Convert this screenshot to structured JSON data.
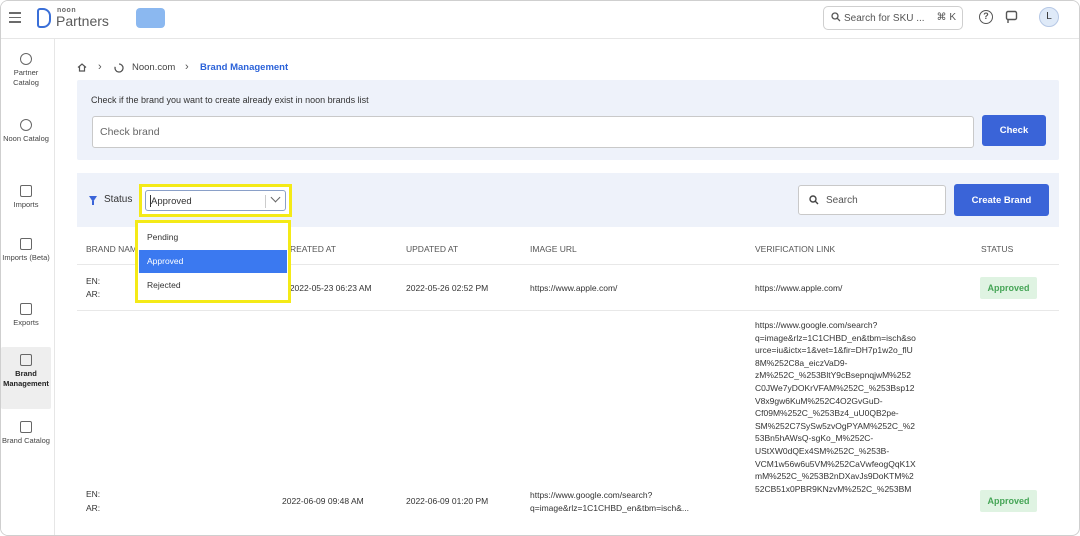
{
  "topbar": {
    "logo_small": "noon",
    "logo_big": "Partners",
    "search_placeholder": "Search for SKU ...",
    "search_shortcut": "⌘ K",
    "help": "?",
    "avatar": "L"
  },
  "sidebar": {
    "items": [
      {
        "label": "Partner Catalog",
        "icon": "partner-catalog-icon"
      },
      {
        "label": "Noon Catalog",
        "icon": "noon-catalog-icon"
      },
      {
        "label": "Imports",
        "icon": "imports-icon"
      },
      {
        "label": "Imports (Beta)",
        "icon": "imports-beta-icon"
      },
      {
        "label": "Exports",
        "icon": "exports-icon"
      },
      {
        "label": "Brand Management",
        "icon": "brand-management-icon",
        "active": true
      },
      {
        "label": "Brand Catalog",
        "icon": "brand-catalog-icon"
      }
    ]
  },
  "breadcrumb": {
    "store": "Noon.com",
    "current": "Brand Management"
  },
  "check": {
    "hint": "Check if the brand you want to create already exist in noon brands list",
    "placeholder": "Check brand",
    "button": "Check"
  },
  "filter": {
    "status_label": "Status",
    "status_value": "Approved",
    "search_placeholder": "Search",
    "create_button": "Create Brand",
    "options": [
      "Pending",
      "Approved",
      "Rejected"
    ],
    "selected_option": "Approved"
  },
  "table": {
    "columns": [
      "BRAND NAM",
      "REATED AT",
      "UPDATED AT",
      "IMAGE URL",
      "VERIFICATION LINK",
      "STATUS"
    ],
    "rows": [
      {
        "brand_en": "EN:",
        "brand_ar": "AR:",
        "created": "2022-05-23 06:23 AM",
        "created_display": "-2022-05-23 06:23 AM",
        "updated": "2022-05-26 02:52 PM",
        "image_url": "https://www.apple.com/",
        "verification_lines": [
          "https://www.apple.com/"
        ],
        "status": "Approved"
      },
      {
        "brand_en": "EN:",
        "brand_ar": "AR:",
        "created": "2022-06-09 09:48 AM",
        "updated": "2022-06-09 01:20 PM",
        "image_url_lines": [
          "https://www.google.com/search?",
          "q=image&rlz=1C1CHBD_en&tbm=isch&..."
        ],
        "verification_lines": [
          "https://www.google.com/search?",
          "q=image&rlz=1C1CHBD_en&tbm=isch&so",
          "urce=iu&ictx=1&vet=1&fir=DH7p1w2o_flU",
          "8M%252C8a_eiczVaD9-",
          "zM%252C_%253BltY9cBsepnqjwM%252",
          "C0JWe7yDOKrVFAM%252C_%253Bsp12",
          "V8x9gw6KuM%252C4O2GvGuD-",
          "Cf09M%252C_%253Bz4_uU0QB2pe-",
          "SM%252C7SySw5zvOgPYAM%252C_%2",
          "53Bn5hAWsQ-sgKo_M%252C-",
          "UStXW0dQEx4SM%252C_%253B-",
          "VCM1w56w6u5VM%252CaVwfeogQqK1X",
          "mM%252C_%253B2nDXavJs9DoKTM%2",
          "52CB51x0PBR9KNzvM%252C_%253BM"
        ],
        "status": "Approved"
      }
    ]
  },
  "colors": {
    "primary": "#3a64d8",
    "link": "#2b62d9",
    "panel": "#eef2fa",
    "highlight": "#f4ea17",
    "approved_bg": "#dff3e2",
    "approved_text": "#45a556",
    "selected_option": "#3b79f0"
  }
}
